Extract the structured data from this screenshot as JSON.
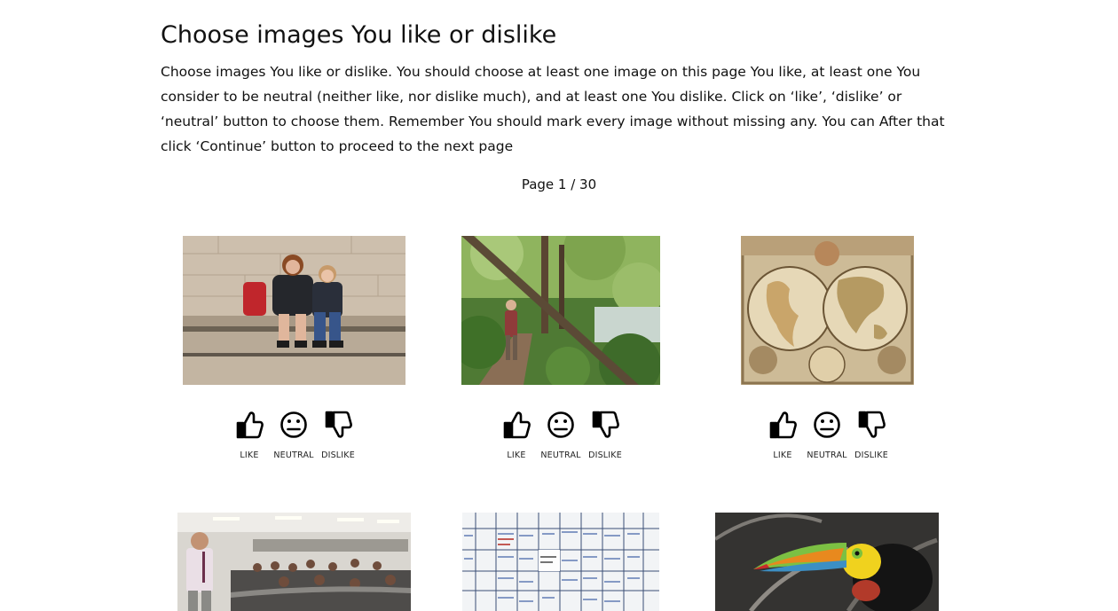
{
  "page": {
    "title": "Choose images You like or dislike",
    "instructions": "Choose images You like or dislike. You should choose at least one image on this page You like, at least one You consider to be neutral (neither like, nor dislike much), and at least one You dislike. Click on ‘like’, ‘dislike’ or ‘neutral’ button to choose them. Remember You should mark every image without missing any. You can After that click ‘Continue’ button to proceed to the next page",
    "pager": "Page 1 / 30"
  },
  "rating_labels": {
    "like": "LIKE",
    "neutral": "NEUTRAL",
    "dislike": "DISLIKE"
  },
  "images": [
    {
      "subject": "two-people-sitting-on-stone-wall"
    },
    {
      "subject": "hiker-on-forest-trail"
    },
    {
      "subject": "antique-world-map"
    },
    {
      "subject": "lecture-hall-presenter"
    },
    {
      "subject": "whiteboard-with-sticky-notes"
    },
    {
      "subject": "toucan-on-branch"
    }
  ],
  "colors": {
    "text": "#111111",
    "background": "#ffffff"
  }
}
